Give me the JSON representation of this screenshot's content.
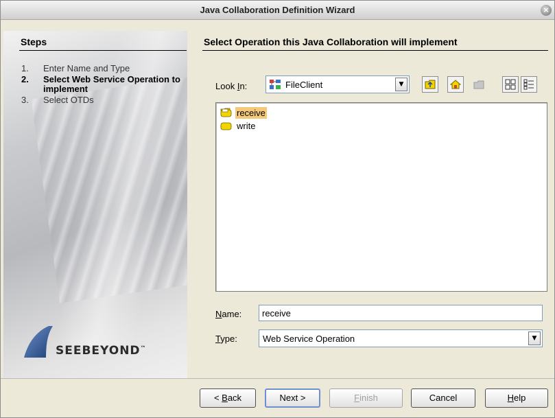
{
  "window": {
    "title": "Java Collaboration Definition Wizard",
    "close_glyph": "×"
  },
  "steps": {
    "heading": "Steps",
    "items": [
      {
        "num": "1.",
        "label": "Enter Name and Type",
        "active": false
      },
      {
        "num": "2.",
        "label": "Select Web Service Operation to implement",
        "active": true
      },
      {
        "num": "3.",
        "label": "Select OTDs",
        "active": false
      }
    ]
  },
  "logo": {
    "text": "SEEBEYOND",
    "trademark": "™"
  },
  "content": {
    "heading": "Select Operation this Java Collaboration will implement"
  },
  "look_in": {
    "label": "Look In:",
    "value": "FileClient",
    "icon": "web-service-icon"
  },
  "toolbar": {
    "up_one_level_icon": "folder-up-icon",
    "home_icon": "home-icon",
    "new_folder_icon": "new-folder-icon",
    "list_view_icon": "list-view-icon",
    "details_view_icon": "details-view-icon"
  },
  "file_list": {
    "items": [
      {
        "label": "receive",
        "selected": true,
        "icon": "folder-open-icon"
      },
      {
        "label": "write",
        "selected": false,
        "icon": "folder-icon"
      }
    ]
  },
  "name_field": {
    "label": "Name:",
    "value": "receive"
  },
  "type_field": {
    "label": "Type:",
    "value": "Web Service Operation"
  },
  "buttons": {
    "back": "< Back",
    "next": "Next >",
    "finish": "Finish",
    "cancel": "Cancel",
    "help": "Help"
  },
  "colors": {
    "selection_highlight": "#f5c97a",
    "default_button_border": "#6d8fd0",
    "folder_yellow": "#f2d400"
  }
}
